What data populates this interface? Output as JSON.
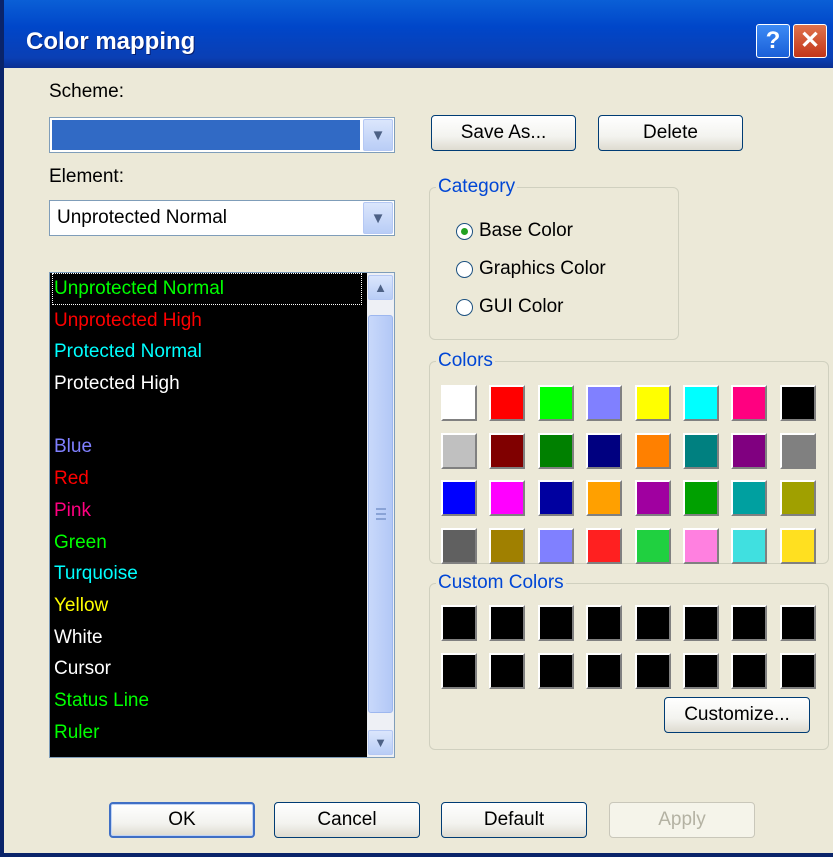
{
  "window": {
    "title": "Color mapping"
  },
  "titlebar": {
    "help_glyph": "?",
    "close_glyph": "✕"
  },
  "scheme": {
    "label": "Scheme:",
    "value": ""
  },
  "element": {
    "label": "Element:",
    "value": "Unprotected Normal"
  },
  "buttons": {
    "save_as": "Save As...",
    "delete": "Delete",
    "customize": "Customize...",
    "ok": "OK",
    "cancel": "Cancel",
    "default": "Default",
    "apply": "Apply"
  },
  "category": {
    "legend": "Category",
    "options": [
      {
        "label": "Base Color",
        "checked": true
      },
      {
        "label": "Graphics Color",
        "checked": false
      },
      {
        "label": "GUI Color",
        "checked": false
      }
    ]
  },
  "colors": {
    "legend": "Colors",
    "swatches": [
      "#ffffff",
      "#ff0000",
      "#00ff00",
      "#8080ff",
      "#ffff00",
      "#00ffff",
      "#ff0080",
      "#000000",
      "#c0c0c0",
      "#800000",
      "#008000",
      "#000080",
      "#ff8000",
      "#008080",
      "#800080",
      "#808080",
      "#0000ff",
      "#ff00ff",
      "#0000a0",
      "#ffa000",
      "#a000a0",
      "#00a000",
      "#00a0a0",
      "#a0a000",
      "#606060",
      "#a08000",
      "#8080ff",
      "#ff2020",
      "#20d040",
      "#ff80e0",
      "#40e0e0",
      "#ffe020"
    ]
  },
  "custom_colors": {
    "legend": "Custom Colors",
    "swatches": [
      "#000000",
      "#000000",
      "#000000",
      "#000000",
      "#000000",
      "#000000",
      "#000000",
      "#000000",
      "#000000",
      "#000000",
      "#000000",
      "#000000",
      "#000000",
      "#000000",
      "#000000",
      "#000000"
    ]
  },
  "element_list": {
    "items": [
      {
        "label": "Unprotected Normal",
        "color": "#00ff00",
        "selected": true
      },
      {
        "label": "Unprotected High",
        "color": "#ff0000"
      },
      {
        "label": "Protected Normal",
        "color": "#00ffff"
      },
      {
        "label": "Protected High",
        "color": "#ffffff"
      },
      {
        "label": "",
        "color": "#ffffff"
      },
      {
        "label": "Blue",
        "color": "#8080ff"
      },
      {
        "label": "Red",
        "color": "#ff0000"
      },
      {
        "label": "Pink",
        "color": "#ff0080"
      },
      {
        "label": "Green",
        "color": "#00ff00"
      },
      {
        "label": "Turquoise",
        "color": "#00ffff"
      },
      {
        "label": "Yellow",
        "color": "#ffff00"
      },
      {
        "label": "White",
        "color": "#ffffff"
      },
      {
        "label": "Cursor",
        "color": "#ffffff"
      },
      {
        "label": "Status Line",
        "color": "#00ff00"
      },
      {
        "label": "Ruler",
        "color": "#00ff00"
      }
    ]
  },
  "icons": {
    "dropdown_arrow": "chevron-down-icon",
    "scroll_up": "chevron-up-icon",
    "scroll_down": "chevron-down-icon"
  },
  "accent": {
    "titlebar": "#0046c9",
    "scheme_fill": "#316ac5",
    "legend_text": "#0046d5"
  }
}
